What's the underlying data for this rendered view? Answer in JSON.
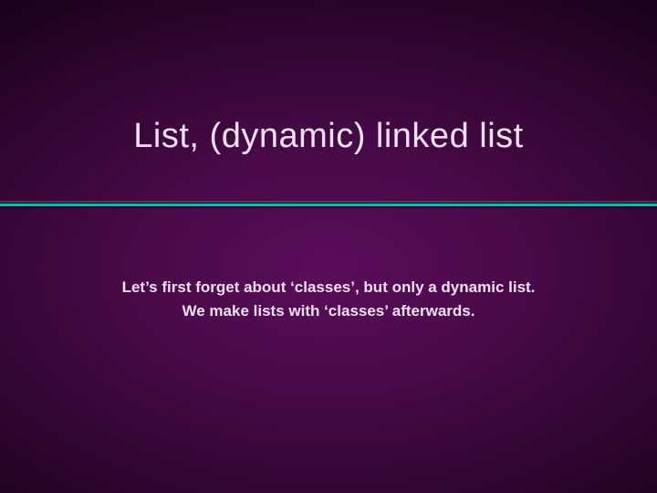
{
  "title": "List, (dynamic) linked list",
  "body": {
    "line1": "Let’s first forget about ‘classes’, but only a dynamic list.",
    "line2": "We make lists  with ‘classes’ afterwards."
  }
}
